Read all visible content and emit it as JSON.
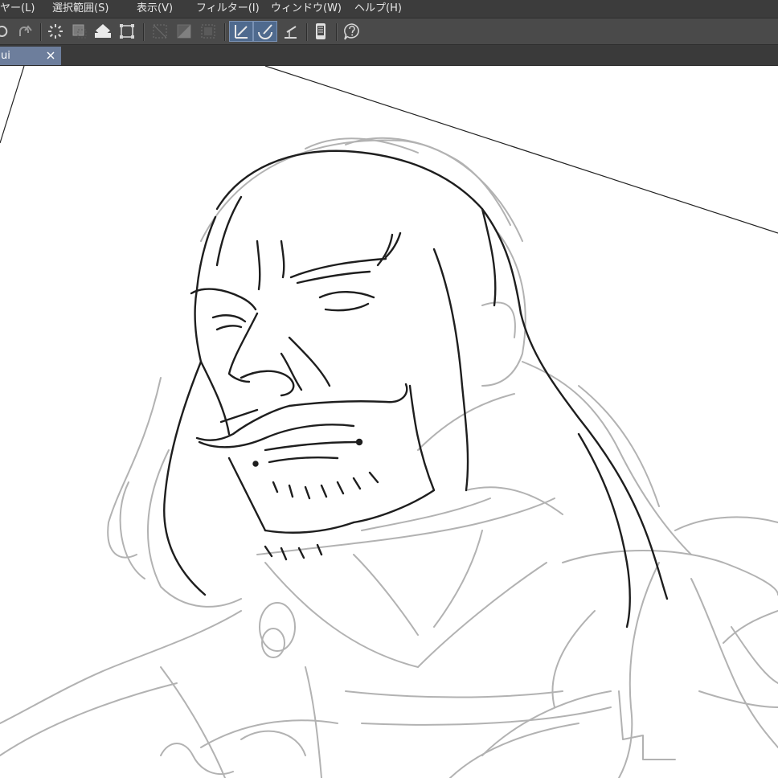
{
  "menubar": {
    "items": [
      {
        "label": "ヤー(L)"
      },
      {
        "label": "選択範囲(S)"
      },
      {
        "label": "表示(V)"
      },
      {
        "label": "フィルター(I)"
      },
      {
        "label": "ウィンドウ(W)"
      },
      {
        "label": "ヘルプ(H)"
      }
    ]
  },
  "toolbar": {
    "buttons": [
      {
        "icon": "undo-icon"
      },
      {
        "icon": "redo-icon"
      },
      {
        "icon": "clear-selection-icon"
      },
      {
        "icon": "select-all-icon"
      },
      {
        "icon": "fill-icon"
      },
      {
        "icon": "transform-icon"
      },
      {
        "icon": "hide-layer-icon"
      },
      {
        "icon": "layer-mask-icon"
      },
      {
        "icon": "selection-border-icon"
      },
      {
        "icon": "ruler-snap-icon",
        "active": true
      },
      {
        "icon": "special-ruler-snap-icon",
        "active": true
      },
      {
        "icon": "grid-snap-icon"
      },
      {
        "icon": "device-icon"
      },
      {
        "icon": "help-icon"
      }
    ]
  },
  "tabs": [
    {
      "label": "ui",
      "active": true
    }
  ],
  "colors": {
    "menubar_bg": "#3c3c3c",
    "toolbar_bg": "#4a4a4a",
    "tab_active": "#6d7e9c",
    "toolbar_active": "#4f6a8e",
    "sketch_dark": "#1e1e1e",
    "sketch_light": "#a8a8a8"
  }
}
